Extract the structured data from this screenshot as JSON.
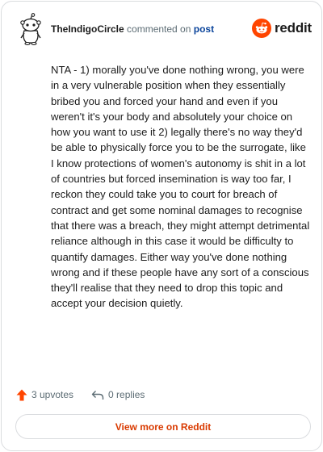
{
  "comment": {
    "username": "TheIndigoCircle",
    "verb": "commented on",
    "post_link": "post",
    "body": "NTA - 1) morally you've done nothing wrong, you were in a very vulnerable position when they essentially bribed you and forced your hand and even if you weren't it's your body and absolutely your choice on how you want to use it 2) legally there's no way they'd be able to physically force you to be the surrogate, like I know protections of women's autonomy is shit in a lot of countries but forced insemination is way too far, I reckon they could take you to court for breach of contract and get some nominal damages to recognise that there was a breach, they might attempt detrimental reliance although in this case it would be difficulty to quantify damages. Either way you've done nothing wrong and if these people have any sort of a conscious they'll realise that they need to drop this topic and accept your decision quietly."
  },
  "brand": {
    "name": "reddit",
    "color": "#ff4500"
  },
  "actions": {
    "upvotes": "3 upvotes",
    "replies": "0 replies"
  },
  "footer": {
    "view_more": "View more on Reddit"
  },
  "colors": {
    "upvote": "#ff4500",
    "link": "#0a449b",
    "view_more": "#d93a00"
  }
}
